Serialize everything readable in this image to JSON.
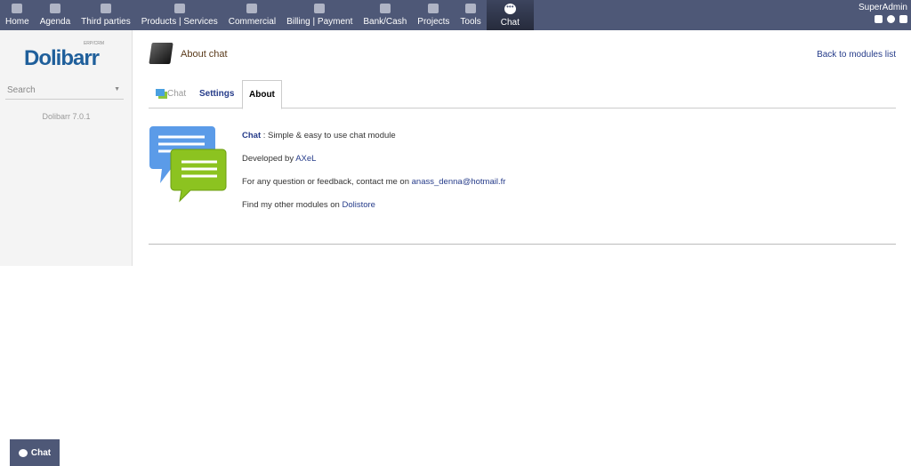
{
  "topnav": {
    "items": [
      {
        "label": "Home"
      },
      {
        "label": "Agenda"
      },
      {
        "label": "Third parties"
      },
      {
        "label": "Products | Services"
      },
      {
        "label": "Commercial"
      },
      {
        "label": "Billing | Payment"
      },
      {
        "label": "Bank/Cash"
      },
      {
        "label": "Projects"
      },
      {
        "label": "Tools"
      },
      {
        "label": "Chat"
      }
    ],
    "active": "Chat",
    "user": "SuperAdmin"
  },
  "sidebar": {
    "logo": "Dolibarr",
    "logo_tag": "ERP/CRM",
    "search_placeholder": "Search",
    "version": "Dolibarr 7.0.1"
  },
  "page": {
    "title": "About chat",
    "back_link": "Back to modules list",
    "tabs": [
      "Chat",
      "Settings",
      "About"
    ]
  },
  "about": {
    "name": "Chat",
    "desc": " : Simple & easy to use chat module",
    "dev_prefix": "Developed by ",
    "dev": "AXeL",
    "contact_prefix": "For any question or feedback, contact me on ",
    "email": "anass_denna@hotmail.fr",
    "store_prefix": "Find my other modules on ",
    "store": "Dolistore"
  },
  "chat_button": "Chat"
}
